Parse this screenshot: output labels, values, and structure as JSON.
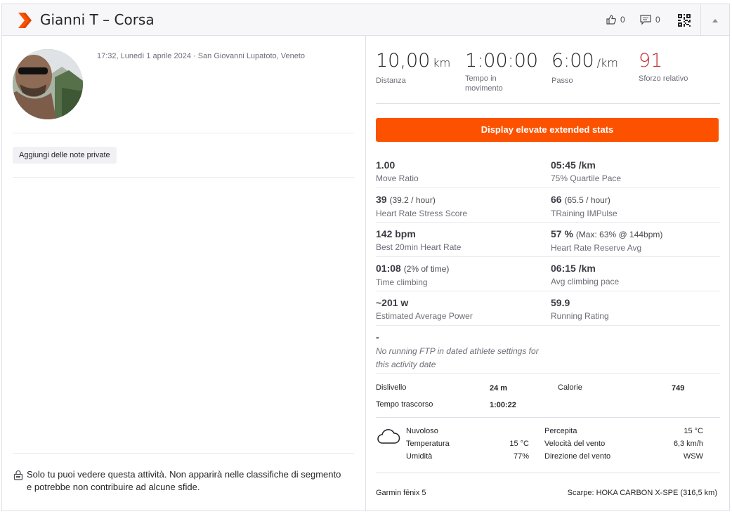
{
  "header": {
    "title": "Gianni T – Corsa",
    "kudos_count": "0",
    "comments_count": "0",
    "brand_color": "#fc5200"
  },
  "left": {
    "meta": "17:32, Lunedì 1 aprile 2024 · San Giovanni Lupatoto, Veneto",
    "notes_button": "Aggiungi delle note private",
    "privacy_notice": "Solo tu puoi vedere questa attività. Non apparirà nelle classifiche di segmento e potrebbe non contribuire ad alcune sfide."
  },
  "primary_stats": [
    {
      "value": "10,00",
      "unit": "km",
      "label": "Distanza"
    },
    {
      "value": "1:00:00",
      "unit": "",
      "label": "Tempo in movimento"
    },
    {
      "value": "6:00",
      "unit": "/km",
      "label": "Passo"
    },
    {
      "value": "91",
      "unit": "",
      "label": "Sforzo relativo",
      "color": "#c1262b"
    }
  ],
  "elevate_button": "Display elevate extended stats",
  "extended_stats": [
    [
      {
        "value": "1.00",
        "extra": "",
        "label": "Move Ratio"
      },
      {
        "value": "05:45 /km",
        "extra": "",
        "label": "75% Quartile Pace"
      }
    ],
    [
      {
        "value": "39",
        "extra": "(39.2 / hour)",
        "label": "Heart Rate Stress Score"
      },
      {
        "value": "66",
        "extra": "(65.5 / hour)",
        "label": "TRaining IMPulse"
      }
    ],
    [
      {
        "value": "142 bpm",
        "extra": "",
        "label": "Best 20min Heart Rate"
      },
      {
        "value": "57 %",
        "extra": "(Max: 63% @ 144bpm)",
        "label": "Heart Rate Reserve Avg"
      }
    ],
    [
      {
        "value": "01:08",
        "extra": "(2% of time)",
        "label": "Time climbing"
      },
      {
        "value": "06:15 /km",
        "extra": "",
        "label": "Avg climbing pace"
      }
    ],
    [
      {
        "value": "~201 w",
        "extra": "",
        "label": "Estimated Average Power"
      },
      {
        "value": "59.9",
        "extra": "",
        "label": "Running Rating"
      }
    ]
  ],
  "ftp": {
    "value": "-",
    "note": "No running FTP in dated athlete settings for this activity date"
  },
  "more_stats": {
    "elevation_label": "Dislivello",
    "elevation_value": "24 m",
    "calories_label": "Calorie",
    "calories_value": "749",
    "elapsed_label": "Tempo trascorso",
    "elapsed_value": "1:00:22"
  },
  "weather": {
    "condition": "Nuvoloso",
    "temp_label": "Temperatura",
    "temp_value": "15 °C",
    "humidity_label": "Umidità",
    "humidity_value": "77%",
    "feels_label": "Percepita",
    "feels_value": "15 °C",
    "wind_speed_label": "Velocità del vento",
    "wind_speed_value": "6,3 km/h",
    "wind_dir_label": "Direzione del vento",
    "wind_dir_value": "WSW"
  },
  "footer": {
    "device": "Garmin fēnix 5",
    "shoes": "Scarpe: HOKA CARBON X-SPE (316,5 km)"
  }
}
